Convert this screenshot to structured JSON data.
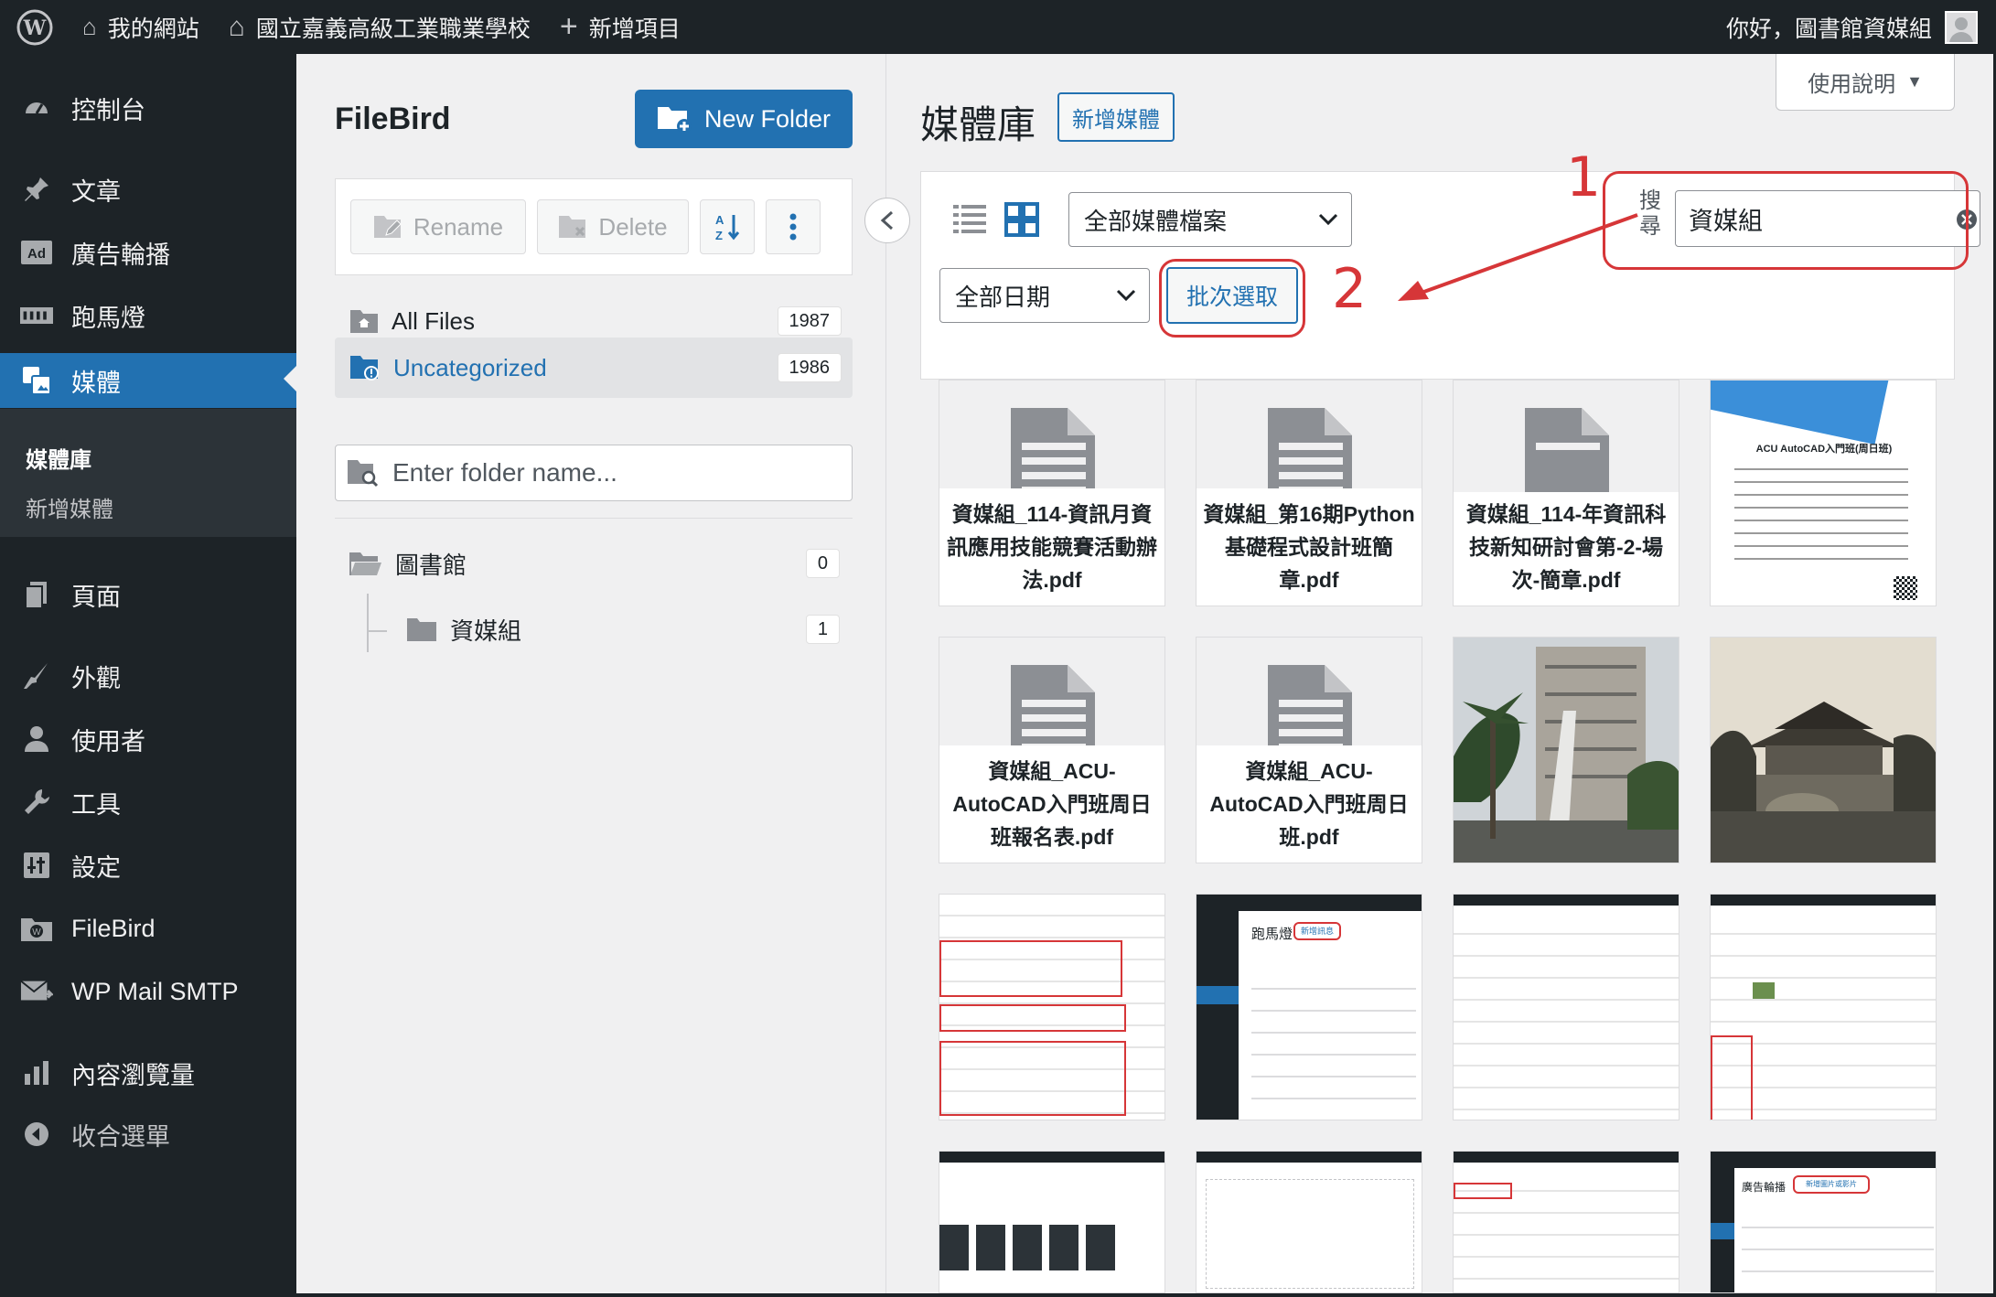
{
  "admin_bar": {
    "site_name": "我的網站",
    "school_name": "國立嘉義高級工業職業學校",
    "new_item": "新增項目",
    "greeting": "你好，圖書館資媒組"
  },
  "sidebar": {
    "items": [
      {
        "label": "控制台"
      },
      {
        "label": "文章"
      },
      {
        "label": "廣告輪播"
      },
      {
        "label": "跑馬燈"
      },
      {
        "label": "媒體"
      },
      {
        "label": "頁面"
      },
      {
        "label": "外觀"
      },
      {
        "label": "使用者"
      },
      {
        "label": "工具"
      },
      {
        "label": "設定"
      },
      {
        "label": "FileBird"
      },
      {
        "label": "WP Mail SMTP"
      },
      {
        "label": "內容瀏覽量"
      },
      {
        "label": "收合選單"
      }
    ],
    "submenu": [
      "媒體庫",
      "新增媒體"
    ]
  },
  "filebird": {
    "title": "FileBird",
    "new_folder": "New Folder",
    "rename": "Rename",
    "delete": "Delete",
    "all_files": {
      "label": "All Files",
      "count": "1987"
    },
    "uncategorized": {
      "label": "Uncategorized",
      "count": "1986"
    },
    "folder_input_placeholder": "Enter folder name...",
    "folders": [
      {
        "label": "圖書館",
        "count": "0"
      },
      {
        "label": "資媒組",
        "count": "1"
      }
    ]
  },
  "media": {
    "title": "媒體庫",
    "add_new": "新增媒體",
    "help": "使用說明",
    "filter_type": "全部媒體檔案",
    "filter_date": "全部日期",
    "bulk_select": "批次選取",
    "search_label": "搜尋",
    "search_value": "資媒組",
    "annotations": [
      "1",
      "2"
    ],
    "files": [
      {
        "name": "資媒組_114-資訊月資訊應用技能競賽活動辦法.pdf"
      },
      {
        "name": "資媒組_第16期Python基礎程式設計班簡章.pdf"
      },
      {
        "name": "資媒組_114-年資訊科技新知研討會第-2-場次-簡章.pdf"
      },
      {
        "name": "ACU AutoCAD入門班(周日班)"
      },
      {
        "name": "資媒組_ACU-AutoCAD入門班周日班報名表.pdf"
      },
      {
        "name": "資媒組_ACU-AutoCAD入門班周日班.pdf"
      }
    ],
    "screenshot_labels": [
      "跑馬燈",
      "新增訊息",
      "廣告輪播",
      "新增圖片或影片"
    ]
  },
  "colors": {
    "admin_dark": "#1d2327",
    "accent": "#2271b1",
    "annotation_red": "#d63638"
  }
}
